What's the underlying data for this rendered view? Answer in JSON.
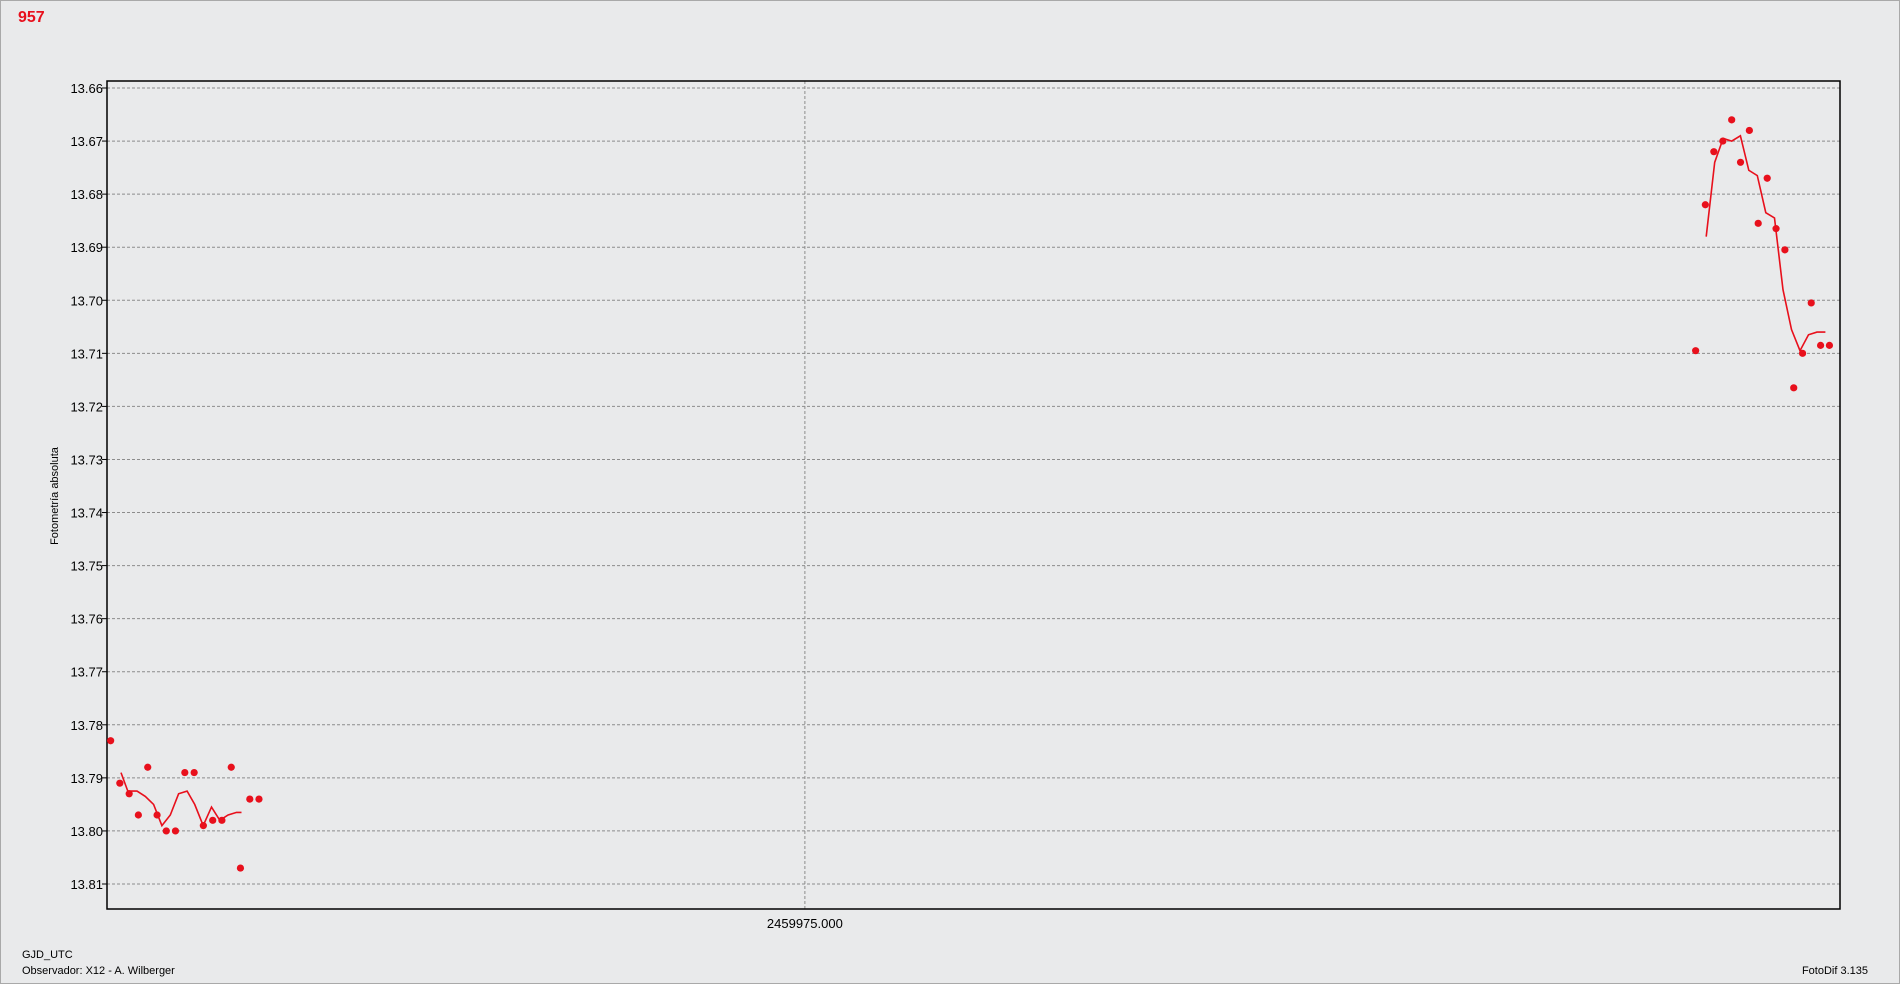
{
  "header": {
    "title": "957"
  },
  "footer": {
    "xlabel": "GJD_UTC",
    "observer": "Observador: X12 - A. Wilberger",
    "version": "FotoDif 3.135"
  },
  "colors": {
    "series": "#e8101c",
    "background": "#e9eaeb",
    "grid": "#8c8c8c",
    "axis": "#000000"
  },
  "chart_data": {
    "type": "scatter",
    "title": "957",
    "xlabel": "GJD_UTC",
    "ylabel": "Fotometría absoluta",
    "y_inverted": true,
    "ylim": [
      13.658,
      13.815
    ],
    "xlim": [
      0,
      1
    ],
    "x_unit_note": "",
    "grid": true,
    "yticks": [
      13.66,
      13.67,
      13.68,
      13.69,
      13.7,
      13.71,
      13.72,
      13.73,
      13.74,
      13.75,
      13.76,
      13.77,
      13.78,
      13.79,
      13.8,
      13.81
    ],
    "ytick_labels": [
      "13.66",
      "13.67",
      "13.68",
      "13.69",
      "13.70",
      "13.71",
      "13.72",
      "13.73",
      "13.74",
      "13.75",
      "13.76",
      "13.77",
      "13.78",
      "13.79",
      "13.80",
      "13.81"
    ],
    "xticks": [
      0.4027
    ],
    "xtick_labels": [
      "2459975.000"
    ],
    "series": [
      {
        "kind": "points",
        "x": [
          0.0021,
          0.0074,
          0.0128,
          0.0181,
          0.0235,
          0.0289,
          0.0342,
          0.0395,
          0.0449,
          0.0503,
          0.0556,
          0.061,
          0.0663,
          0.0717,
          0.077,
          0.0824,
          0.0877,
          0.9167,
          0.9223,
          0.9272,
          0.9324,
          0.9375,
          0.9426,
          0.9477,
          0.9528,
          0.958,
          0.9631,
          0.9682,
          0.9733,
          0.9784,
          0.9834,
          0.9888,
          0.9939
        ],
        "y": [
          13.783,
          13.791,
          13.793,
          13.797,
          13.788,
          13.797,
          13.8,
          13.8,
          13.789,
          13.789,
          13.799,
          13.798,
          13.798,
          13.788,
          13.807,
          13.794,
          13.794,
          13.7095,
          13.682,
          13.672,
          13.67,
          13.666,
          13.674,
          13.668,
          13.6855,
          13.677,
          13.6865,
          13.6905,
          13.7165,
          13.71,
          13.7005,
          13.7085,
          13.7085
        ]
      },
      {
        "kind": "line",
        "x": [
          0.0081,
          0.012,
          0.0173,
          0.0221,
          0.0269,
          0.0317,
          0.0365,
          0.0413,
          0.0462,
          0.0506,
          0.0555,
          0.0603,
          0.0651,
          0.0699,
          0.0747,
          0.0776
        ],
        "y": [
          13.789,
          13.7925,
          13.7925,
          13.7935,
          13.795,
          13.799,
          13.797,
          13.793,
          13.7925,
          13.795,
          13.799,
          13.7955,
          13.798,
          13.797,
          13.7965,
          13.7965
        ]
      },
      {
        "kind": "line",
        "x": [
          0.9228,
          0.9277,
          0.9326,
          0.9375,
          0.9425,
          0.9474,
          0.9523,
          0.9572,
          0.9622,
          0.9671,
          0.972,
          0.9769,
          0.9818,
          0.9867,
          0.9916
        ],
        "y": [
          13.688,
          13.674,
          13.6695,
          13.67,
          13.669,
          13.6755,
          13.6765,
          13.6835,
          13.6845,
          13.698,
          13.7055,
          13.7095,
          13.7065,
          13.706,
          13.706
        ]
      }
    ]
  }
}
